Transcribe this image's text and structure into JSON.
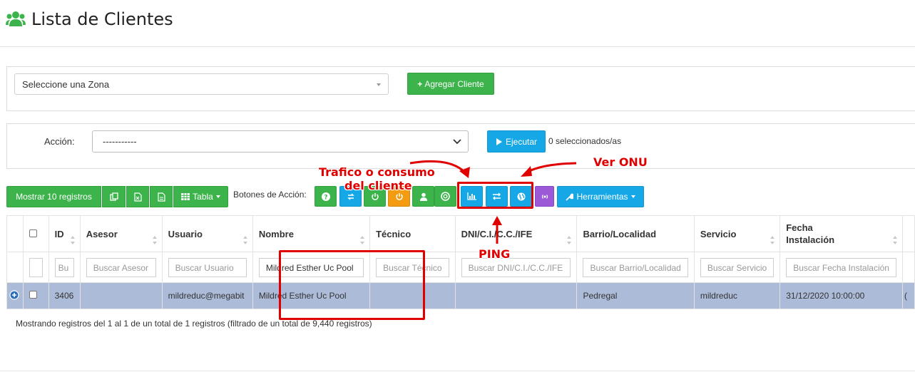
{
  "page": {
    "title": "Lista de Clientes",
    "title_icon": "users-icon"
  },
  "zone": {
    "placeholder": "Seleccione una Zona",
    "add_button": "Agregar Cliente"
  },
  "action": {
    "label": "Acción:",
    "selected": "-----------",
    "execute_button": "Ejecutar",
    "selected_count": "0 seleccionados/as"
  },
  "toolbar": {
    "show_records": "Mostrar 10 registros",
    "export_icons": [
      "copy-icon",
      "excel-icon",
      "pdf-icon"
    ],
    "table_button": "Tabla",
    "actions_label": "Botones de Acción:",
    "action_icons": [
      {
        "icon": "question-icon",
        "color": "#3cb44b"
      },
      {
        "icon": "sync-icon",
        "color": "#16a8e6"
      },
      {
        "icon": "power-icon",
        "color": "#3cb44b"
      },
      {
        "icon": "power-icon",
        "color": "#f39c12"
      },
      {
        "icon": "user-icon",
        "color": "#3cb44b"
      },
      {
        "icon": "lifebuoy-icon",
        "color": "#3cb44b"
      },
      {
        "icon": "bar-chart-icon",
        "color": "#16a8e6"
      },
      {
        "icon": "exchange-icon",
        "color": "#16a8e6"
      },
      {
        "icon": "globe-icon",
        "color": "#16a8e6"
      },
      {
        "icon": "signal-icon",
        "color": "#9b59d8"
      }
    ],
    "tools_button": "Herramientas"
  },
  "table": {
    "columns": [
      "",
      "",
      "ID",
      "Asesor",
      "Usuario",
      "Nombre",
      "Técnico",
      "DNI/C.I./C.C./IFE",
      "Barrio/Localidad",
      "Servicio",
      "Fecha Instalación",
      ""
    ],
    "filters": [
      "",
      "",
      "Bu",
      "Buscar Asesor",
      "Buscar Usuario",
      "Mildred Esther Uc Pool",
      "Buscar Técnico",
      "Buscar DNI/C.I./C.C./IFE",
      "Buscar Barrio/Localidad",
      "Buscar Servicio",
      "Buscar Fecha Instalación",
      ""
    ],
    "rows": [
      [
        "",
        "",
        "3406",
        "",
        "mildreduc@megabit",
        "Mildred Esther Uc Pool",
        "",
        "",
        "Pedregal",
        "mildreduc",
        "31/12/2020 10:00:00",
        "("
      ]
    ]
  },
  "footer": {
    "info": "Mostrando registros del 1 al 1 de un total de 1 registros (filtrado de un total de 9,440 registros)"
  },
  "annotations": {
    "traffic_line1": "Trafico o consumo",
    "traffic_line2": "del cliente",
    "onu": "Ver ONU",
    "ping": "PING",
    "color": "#e00000"
  }
}
